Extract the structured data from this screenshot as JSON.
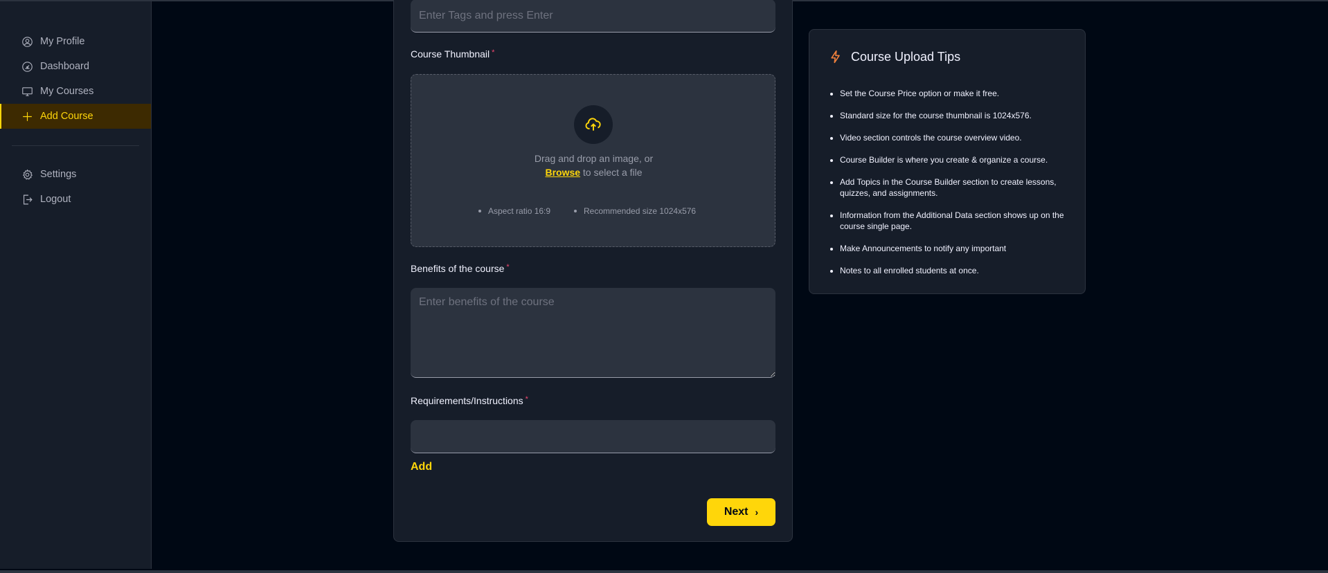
{
  "sidebar": {
    "items": [
      {
        "label": "My Profile",
        "icon": "user-circle-icon"
      },
      {
        "label": "Dashboard",
        "icon": "gauge-icon"
      },
      {
        "label": "My Courses",
        "icon": "monitor-icon"
      },
      {
        "label": "Add Course",
        "icon": "plus-icon",
        "active": true
      }
    ],
    "bottom_items": [
      {
        "label": "Settings",
        "icon": "gear-icon"
      },
      {
        "label": "Logout",
        "icon": "logout-icon"
      }
    ]
  },
  "form": {
    "tags": {
      "placeholder": "Enter Tags and press Enter"
    },
    "thumbnail": {
      "label": "Course Thumbnail",
      "required_mark": "*",
      "drag_text": "Drag and drop an image, or",
      "browse_label": "Browse",
      "select_text": " to select a file",
      "hints": [
        "Aspect ratio 16:9",
        "Recommended size 1024x576"
      ]
    },
    "benefits": {
      "label": "Benefits of the course",
      "required_mark": "*",
      "placeholder": "Enter benefits of the course"
    },
    "requirements": {
      "label": "Requirements/Instructions",
      "required_mark": "*",
      "value": ""
    },
    "add_label": "Add",
    "next_label": "Next",
    "next_icon": "chevron-right-icon"
  },
  "tips": {
    "title": "Course Upload Tips",
    "icon": "lightning-icon",
    "items": [
      "Set the Course Price option or make it free.",
      "Standard size for the course thumbnail is 1024x576.",
      "Video section controls the course overview video.",
      "Course Builder is where you create & organize a course.",
      "Add Topics in the Course Builder section to create lessons, quizzes, and assignments.",
      "Information from the Additional Data section shows up on the course single page.",
      "Make Announcements to notify any important",
      "Notes to all enrolled students at once."
    ]
  },
  "colors": {
    "background": "#000814",
    "panel": "#161d29",
    "input": "#2c333f",
    "accent": "#ffd60a",
    "required": "#ef476f"
  }
}
